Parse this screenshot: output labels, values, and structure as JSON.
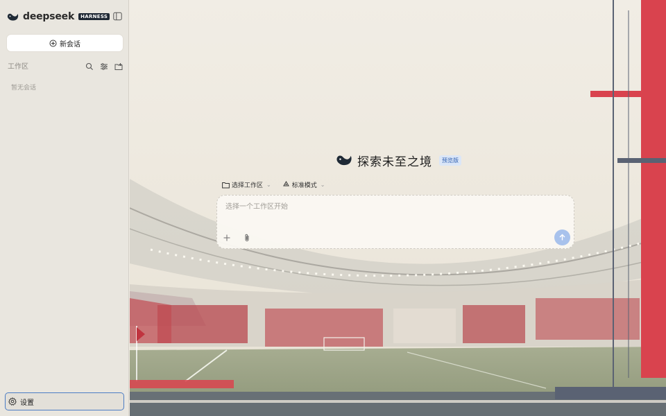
{
  "brand": {
    "name": "deepseek",
    "badge": "HARNESS"
  },
  "sidebar": {
    "new_chat_label": "新会话",
    "workspace_label": "工作区",
    "empty_label": "暂无会话",
    "settings_label": "设置"
  },
  "main": {
    "title": "探索未至之境",
    "badge": "预览版",
    "workspace_select": "选择工作区",
    "mode_select": "标准模式",
    "composer_placeholder": "选择一个工作区开始"
  },
  "colors": {
    "accent": "#4b7cc4",
    "send_button": "#a8c2ec",
    "stripe_red": "#d9434e",
    "stripe_slate": "#5a6273"
  },
  "icons": [
    "whale-logo-icon",
    "sidebar-toggle-icon",
    "plus-circle-icon",
    "search-icon",
    "filter-icon",
    "new-folder-icon",
    "gear-icon",
    "folder-icon",
    "recycle-icon",
    "chevron-down-icon",
    "plus-icon",
    "paperclip-icon",
    "arrow-up-icon"
  ]
}
